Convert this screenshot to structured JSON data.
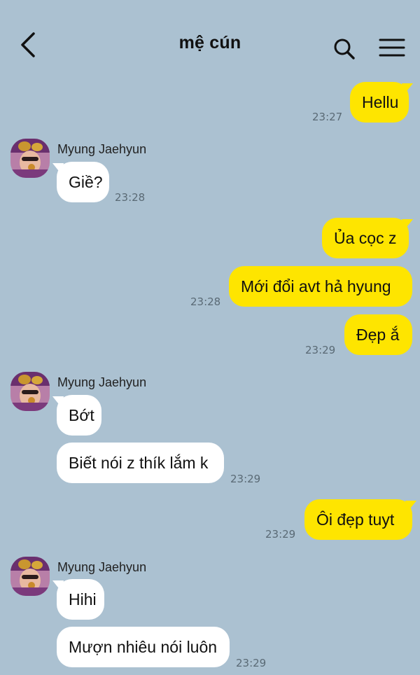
{
  "header": {
    "title": "mệ cún",
    "back_icon": "chevron-left-icon",
    "search_icon": "search-icon",
    "menu_icon": "hamburger-menu-icon"
  },
  "colors": {
    "background": "#abc1d1",
    "outgoing_bubble": "#fee500",
    "incoming_bubble": "#ffffff",
    "time_text": "#5a6a75"
  },
  "messages": {
    "m1": {
      "text": "Hellu",
      "time": "23:27"
    },
    "g1": {
      "sender": "Myung Jaehyun",
      "m2": {
        "text": "Giề?",
        "time": "23:28"
      }
    },
    "m3": {
      "text": "Ủa cọc z"
    },
    "m4": {
      "text": "Mới đổi avt hả hyung",
      "time": "23:28"
    },
    "m5": {
      "text": "Đẹp ắ",
      "time": "23:29"
    },
    "g2": {
      "sender": "Myung Jaehyun",
      "m6": {
        "text": "Bớt"
      },
      "m7": {
        "text": "Biết nói z thík lắm k",
        "time": "23:29"
      }
    },
    "m8": {
      "text": "Ôi đẹp tuyt",
      "time": "23:29"
    },
    "g3": {
      "sender": "Myung Jaehyun",
      "m9": {
        "text": "Hihi"
      },
      "m10": {
        "text": "Mượn nhiêu nói luôn",
        "time": "23:29"
      }
    }
  }
}
